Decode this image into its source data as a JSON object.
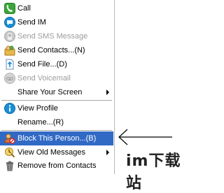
{
  "menu": {
    "items": [
      {
        "label": "Call"
      },
      {
        "label": "Send IM"
      },
      {
        "label": "Send SMS Message"
      },
      {
        "label": "Send Contacts...(N)"
      },
      {
        "label": "Send File...(D)"
      },
      {
        "label": "Send Voicemail"
      },
      {
        "label": "Share Your Screen"
      },
      {
        "label": "View Profile"
      },
      {
        "label": "Rename...(R)"
      },
      {
        "label": "Block This Person...(B)"
      },
      {
        "label": "View Old Messages"
      },
      {
        "label": "Remove from Contacts"
      }
    ]
  },
  "watermark": {
    "text": "im下载站"
  },
  "colors": {
    "highlight": "#316ac5",
    "disabled_text": "#9c9c9c",
    "skype_blue": "#1a8fd6"
  }
}
